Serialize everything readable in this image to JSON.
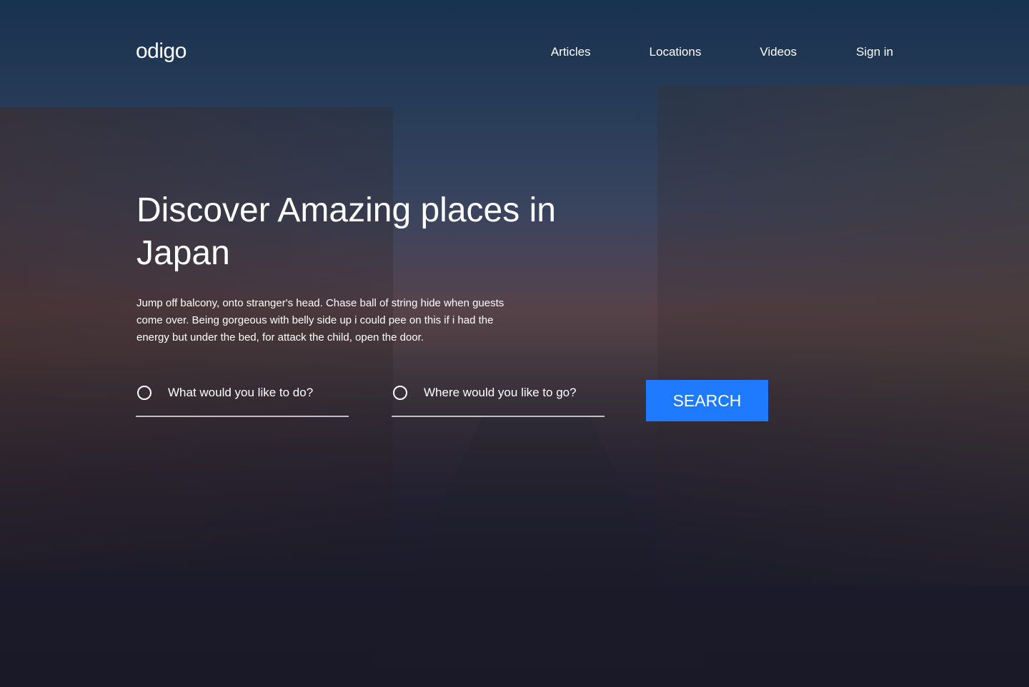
{
  "header": {
    "logo": "odigo",
    "nav": {
      "articles": "Articles",
      "locations": "Locations",
      "videos": "Videos",
      "sign_in": "Sign in"
    }
  },
  "hero": {
    "title": "Discover Amazing places in Japan",
    "description": "Jump off balcony, onto stranger's head. Chase ball of string hide when guests come over. Being gorgeous with belly side up i could pee on this if i had the energy but under the bed, for attack the child, open the door."
  },
  "search": {
    "activity_placeholder": "What would you like to do?",
    "location_placeholder": "Where would you like to go?",
    "button_label": "SEARCH"
  },
  "colors": {
    "primary_blue": "#1e7aff",
    "text_white": "#ffffff"
  }
}
